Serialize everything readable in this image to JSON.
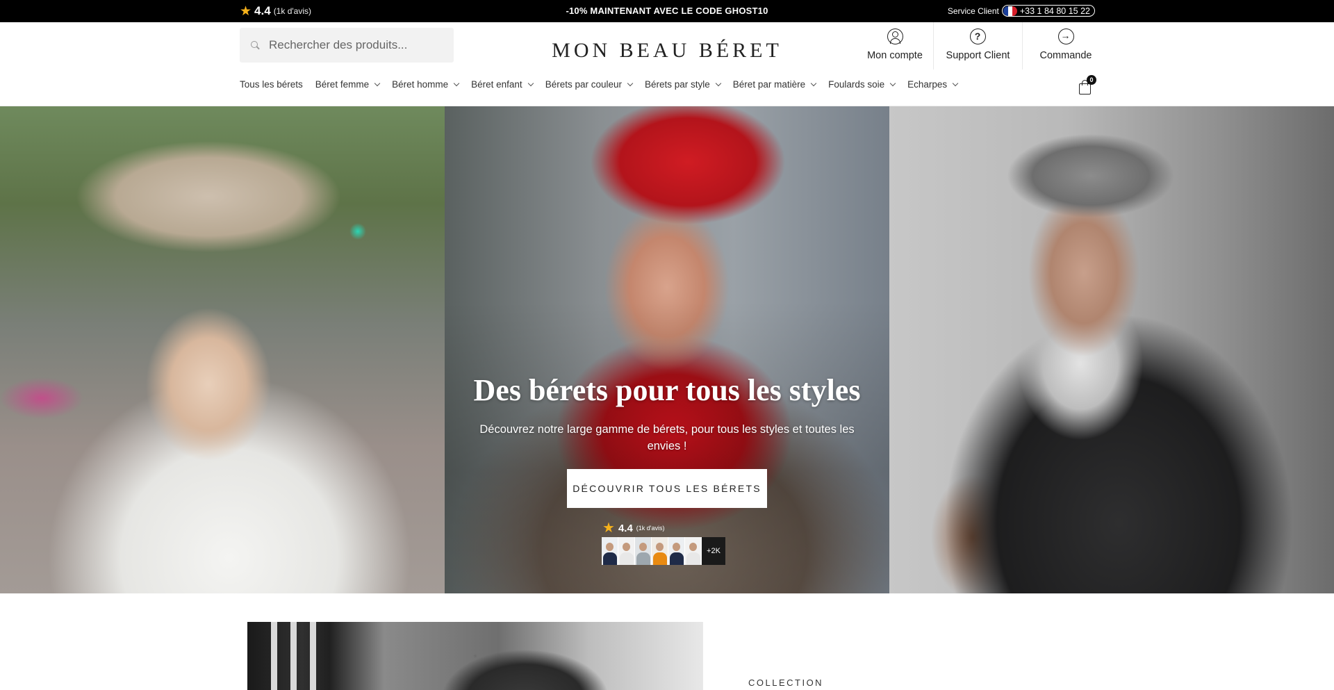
{
  "topbar": {
    "rating_score": "4.4",
    "rating_reviews": "(1k d'avis)",
    "promo": "-10% MAINTENANT AVEC LE CODE GHOST10",
    "service_label": "Service Client",
    "phone": "+33 1 84 80 15 22"
  },
  "header": {
    "search_placeholder": "Rechercher des produits...",
    "logo": "MON BEAU BÉRET",
    "actions": [
      {
        "label": "Mon compte",
        "icon": "user-icon"
      },
      {
        "label": "Support Client",
        "icon": "help-icon"
      },
      {
        "label": "Commande",
        "icon": "arrow-right-icon"
      }
    ],
    "help_glyph": "?",
    "arrow_glyph": "→",
    "cart_count": "0"
  },
  "nav": {
    "items": [
      {
        "label": "Tous les bérets"
      },
      {
        "label": "Béret femme"
      },
      {
        "label": "Béret homme"
      },
      {
        "label": "Béret enfant"
      },
      {
        "label": "Bérets par couleur"
      },
      {
        "label": "Bérets par style"
      },
      {
        "label": "Béret par matière"
      },
      {
        "label": "Foulards soie"
      },
      {
        "label": "Echarpes"
      }
    ]
  },
  "hero": {
    "title": "Des bérets pour tous les styles",
    "subtitle": "Découvrez notre large gamme de bérets, pour tous les styles et toutes les envies !",
    "cta": "DÉCOUVRIR TOUS LES BÉRETS",
    "rating_score": "4.4",
    "rating_reviews": "(1k d'avis)",
    "more_count": "+2K"
  },
  "section": {
    "collection_label": "COLLECTION"
  },
  "colors": {
    "topbar_bg": "#000000",
    "star": "#f6b21b",
    "accent_text": "#222222"
  }
}
